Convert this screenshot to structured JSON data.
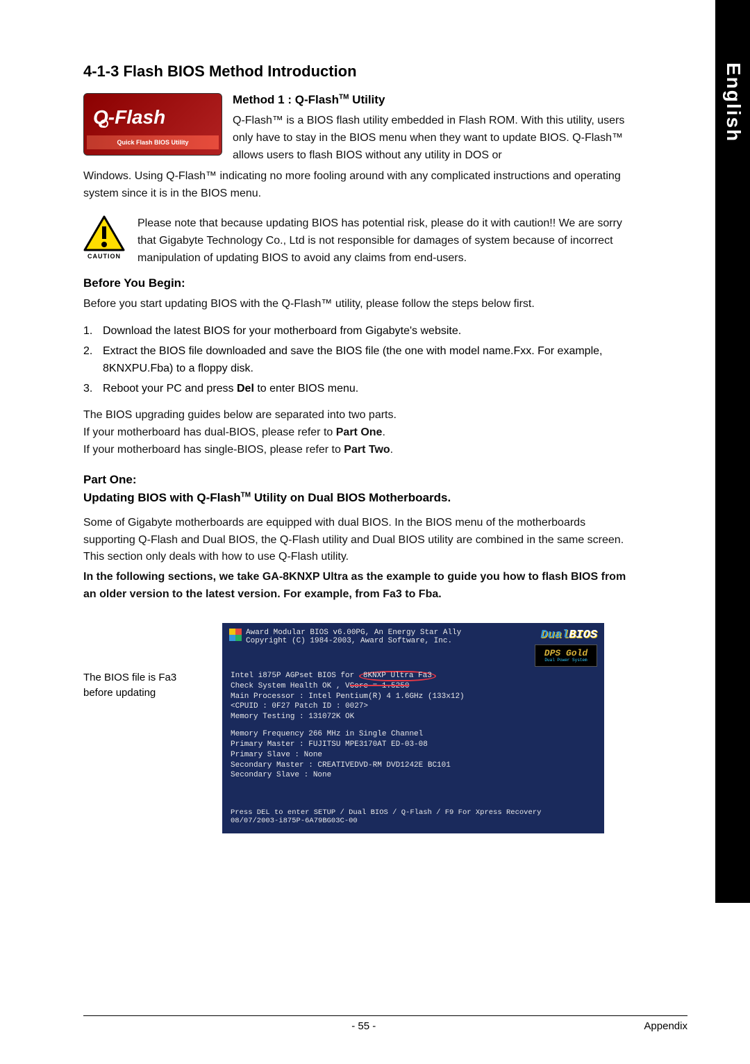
{
  "sidebar": {
    "label": "English"
  },
  "section_title": "4-1-3  Flash BIOS Method Introduction",
  "qflash_bar": "Quick Flash BIOS Utility",
  "method1": {
    "title": "Method 1 : Q-Flash™ Utility",
    "para": "Q-Flash™ is a BIOS flash utility embedded in Flash ROM. With this utility, users only have to stay in the BIOS menu when they want to update BIOS. Q-Flash™ allows users to flash BIOS without any utility in DOS or",
    "cont": "Windows. Using Q-Flash™ indicating no more fooling around with any complicated instructions and operating system since it is in the BIOS menu."
  },
  "caution": {
    "label": "CAUTION",
    "text": "Please note that because updating BIOS has potential risk, please do it with caution!! We are sorry that Gigabyte Technology Co., Ltd is not responsible for damages of system because of incorrect manipulation of updating BIOS to avoid any claims from end-users."
  },
  "before": {
    "title": "Before You Begin:",
    "intro": "Before you start updating BIOS with the Q-Flash™ utility, please follow the steps below first.",
    "steps": [
      "Download the latest BIOS for your motherboard from Gigabyte's website.",
      "Extract the BIOS file downloaded and save the BIOS file (the one with model name.Fxx. For example, 8KNXPU.Fba) to a floppy disk.",
      "Reboot your PC and press Del to enter BIOS menu."
    ],
    "post1": "The BIOS upgrading guides below are separated into two parts.",
    "post2": "If your motherboard has dual-BIOS, please refer to Part One.",
    "post3": "If your motherboard has single-BIOS, please refer to Part Two."
  },
  "partone": {
    "label": "Part One:",
    "title": "Updating BIOS with Q-Flash™ Utility on Dual BIOS Motherboards.",
    "para": "Some of Gigabyte motherboards are equipped with dual BIOS. In the BIOS menu of the motherboards supporting Q-Flash and Dual BIOS, the Q-Flash utility and Dual BIOS utility are combined in the same screen. This section only deals with how to use Q-Flash utility.",
    "bold": "In the following sections, we take GA-8KNXP Ultra as the example to guide you how to flash BIOS from an older version to the latest version. For example, from Fa3 to Fba."
  },
  "bios_note": "The BIOS file is Fa3 before updating",
  "bios": {
    "hdr1": "Award Modular BIOS v6.00PG, An Energy Star Ally",
    "hdr2": "Copyright (C) 1984-2003, Award Software, Inc.",
    "l1a": "Intel i875P AGPset BIOS for",
    "l1b": "8KNXP Ultra Fa3",
    "l2a": "Check System Health OK , V",
    "l2b": "Core = 1.5250",
    "l3": "Main Processor : Intel Pentium(R) 4  1.6GHz (133x12)",
    "l4": "<CPUID : 0F27 Patch ID  : 0027>",
    "l5": "Memory Testing  : 131072K OK",
    "b1": "Memory Frequency 266 MHz in Single Channel",
    "b2": "Primary Master : FUJITSU MPE3170AT ED-03-08",
    "b3": "Primary Slave : None",
    "b4": "Secondary Master : CREATIVEDVD-RM DVD1242E BC101",
    "b5": "Secondary Slave : None",
    "f1": "Press DEL to enter SETUP / Dual BIOS / Q-Flash / F9 For Xpress Recovery",
    "f2": "08/07/2003-i875P-6A79BG03C-00",
    "dual": "Dual",
    "bios_word": "BIOS",
    "dps": "DPS",
    "gold": "Gold",
    "dps_sub": "Dual Power System"
  },
  "footer": {
    "page": "- 55 -",
    "label": "Appendix"
  }
}
